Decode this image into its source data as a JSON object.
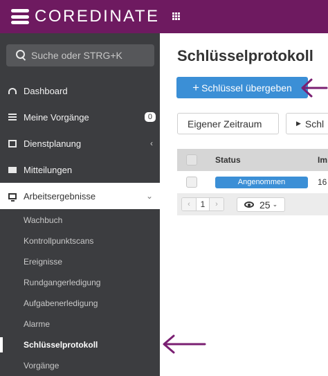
{
  "app": {
    "brand": "COREDINATE"
  },
  "search": {
    "placeholder": "Suche oder STRG+K"
  },
  "sidebar": {
    "items": [
      {
        "label": "Dashboard"
      },
      {
        "label": "Meine Vorgänge",
        "badge": "0"
      },
      {
        "label": "Dienstplanung"
      },
      {
        "label": "Mitteilungen"
      },
      {
        "label": "Arbeitsergebnisse"
      }
    ],
    "subitems": [
      {
        "label": "Wachbuch"
      },
      {
        "label": "Kontrollpunktscans"
      },
      {
        "label": "Ereignisse"
      },
      {
        "label": "Rundgangerledigung"
      },
      {
        "label": "Aufgabenerledigung"
      },
      {
        "label": "Alarme"
      },
      {
        "label": "Schlüsselprotokoll"
      },
      {
        "label": "Vorgänge"
      }
    ]
  },
  "main": {
    "title": "Schlüsselprotokoll",
    "primary_button": "Schlüssel übergeben",
    "period_button": "Eigener Zeitraum",
    "more_button": "Schl",
    "table": {
      "headers": {
        "status": "Status",
        "col3": "Im"
      },
      "rows": [
        {
          "status": "Angenommen",
          "col3": "16"
        }
      ]
    },
    "pager": {
      "current_page": "1",
      "per_page": "25"
    }
  },
  "colors": {
    "brand": "#6e1a60",
    "sidebar": "#3c3d40",
    "accent": "#3b8fd6",
    "annotation": "#7a1f72"
  }
}
